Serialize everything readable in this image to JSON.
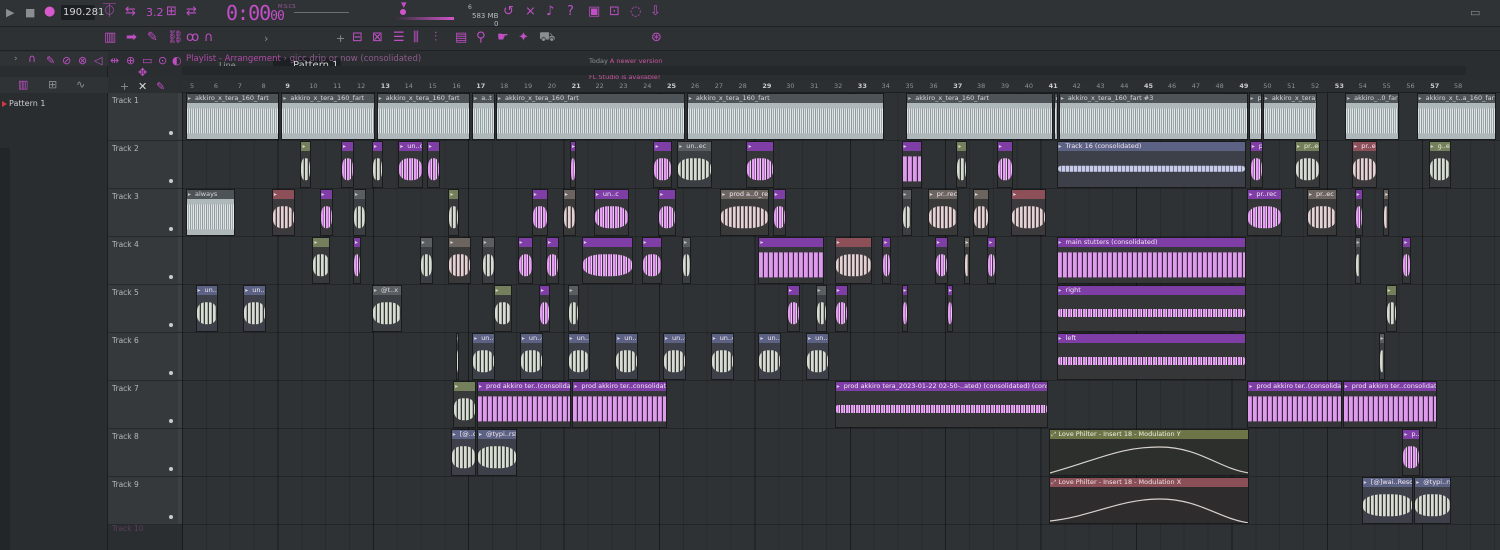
{
  "transport": {
    "tempo": "190.281",
    "time": "0:00",
    "time_sub": "00",
    "time_unit": "M:S:CS",
    "cpu_top": "6",
    "ram": "583 MB",
    "ram_sub": "0"
  },
  "toolbar": {
    "snap": "Line",
    "pattern": "Pattern 1",
    "news_line1": "Today",
    "news_line2": "A newer version of",
    "news_line3": "FL Studio is available!"
  },
  "browser": {
    "pattern_item": "Pattern 1"
  },
  "playlist": {
    "title": "Playlist - Arrangement",
    "subtitle": "gicc drip or now (consolidated)",
    "tracks": [
      "Track 1",
      "Track 2",
      "Track 3",
      "Track 4",
      "Track 5",
      "Track 6",
      "Track 7",
      "Track 8",
      "Track 9",
      "Track 10"
    ],
    "bars": [
      "5",
      "6",
      "7",
      "8",
      "9",
      "10",
      "11",
      "12",
      "13",
      "14",
      "15",
      "16",
      "17",
      "18",
      "19",
      "20",
      "21",
      "22",
      "23",
      "24",
      "25",
      "26",
      "27",
      "28",
      "29",
      "30",
      "31",
      "32",
      "33",
      "34",
      "35",
      "36",
      "37",
      "38",
      "39",
      "40",
      "41",
      "42",
      "43",
      "44",
      "45",
      "46",
      "47",
      "48",
      "49",
      "50",
      "51",
      "52",
      "53",
      "54",
      "55",
      "56",
      "57",
      "58"
    ],
    "major_bars": [
      "9",
      "13",
      "17",
      "21",
      "25",
      "29",
      "33",
      "37",
      "41",
      "45",
      "49",
      "53",
      "57"
    ]
  },
  "clips": {
    "t1a": "akkiro_x_tera_160_fart",
    "t1b": "akkiro_x_tera_160_fart",
    "t1c": "akkiro_x_tera_160_fart",
    "t1d": "a..t",
    "t1e": "akkiro_x_tera_160_fart",
    "t1f": "akkiro_x_tera_160_fart",
    "t1g": "akkiro_x_tera_160_fart",
    "t1h": "akkiro_x_tera_160_fart",
    "t1i": "akkiro_x_tera_160_fart #3",
    "t1j": "p..t",
    "t1k": "akkiro_x_tera_160_fart",
    "t1l": "akkiro_..0_fart",
    "t1m": "akkiro_x_t..a_160_fart",
    "t2a": "un..c",
    "t2b": "un..ec",
    "t2c": "Track 16 (consolidated)",
    "t2d": "p..c",
    "t2e": "pr..ec",
    "t2f": "pr..ec",
    "t2g": "g..ed",
    "t3a": "always",
    "t3b": "un..c",
    "t3c": "prod a..0_rec",
    "t3d": "pr..rec",
    "t3e": "pr..rec",
    "t3f": "pr..ec",
    "t4a": "main stutters (consolidated)",
    "t5a": "un..c",
    "t5b": "un..c",
    "t5c": "@t..x",
    "t5d": "right",
    "t6a": "left",
    "t6u": "un..c",
    "t7a": "prod akkiro ter..(consolidated)",
    "t7b": "prod akkiro ter..consolidated)",
    "t7c": "prod akkiro tera_2023-01-22 02-50-..ated) (consolidated) (consolidated)",
    "t7d": "prod akkiro ter..(consolidated)",
    "t7e": "prod akkiro ter..consolidated)",
    "t8a": "[@..o",
    "t8b": "@typi..rsfx",
    "t8c": "Love Philter - Insert 18 - Modulation Y",
    "t8d": "p..c",
    "t9a": "Love Philter - Insert 18 - Modulation X",
    "t9b": "[@]wai..Reso",
    "t9c": "@typi..rsfx"
  },
  "colors": {
    "accent": "#c44fc8",
    "clip_purple": "#7e3ea6",
    "clip_light": "#aeb7b9",
    "automation_y": "#6c7448",
    "automation_x": "#8a4f57"
  }
}
